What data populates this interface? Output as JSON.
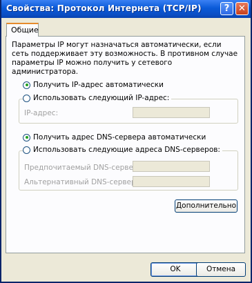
{
  "window": {
    "title": "Свойства: Протокол Интернета (TCP/IP)",
    "help_glyph": "?",
    "close_glyph": "✕"
  },
  "tabs": [
    {
      "label": "Общие",
      "active": true
    }
  ],
  "description": "Параметры IP могут назначаться автоматически, если сеть поддерживает эту возможность. В противном случае параметры IP можно получить у сетевого администратора.",
  "ip_section": {
    "auto_label": "Получить IP-адрес автоматически",
    "manual_label": "Использовать следующий IP-адрес:",
    "ip_address_label": "IP-адрес:",
    "ip_address_value": ""
  },
  "dns_section": {
    "auto_label": "Получить адрес DNS-сервера автоматически",
    "manual_label": "Использовать следующие адреса DNS-серверов:",
    "preferred_label": "Предпочитаемый DNS-сервер:",
    "alternate_label": "Альтернативный DNS-сервер:",
    "preferred_value": "",
    "alternate_value": ""
  },
  "buttons": {
    "advanced": "Дополнительно",
    "ok": "OK",
    "cancel": "Отмена"
  },
  "colors": {
    "title_bar": "#0a5ad8",
    "radio_selected": "#21a121",
    "tab_highlight": "#e68b2c"
  }
}
